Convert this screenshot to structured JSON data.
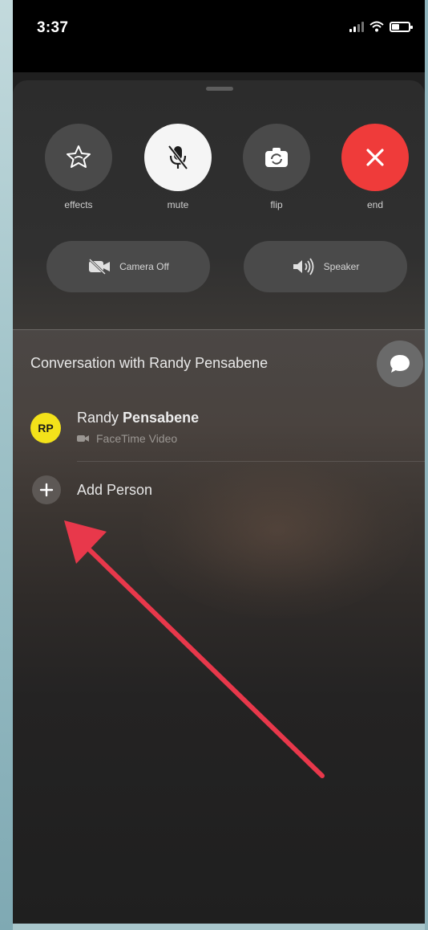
{
  "status_bar": {
    "time": "3:37"
  },
  "controls": [
    {
      "icon": "effects-star-icon",
      "label": "effects",
      "style": "gray"
    },
    {
      "icon": "mic-muted-icon",
      "label": "mute",
      "style": "white"
    },
    {
      "icon": "camera-flip-icon",
      "label": "flip",
      "style": "gray"
    },
    {
      "icon": "close-icon",
      "label": "end",
      "style": "red"
    }
  ],
  "pills": [
    {
      "icon": "video-off-icon",
      "label": "Camera Off"
    },
    {
      "icon": "speaker-icon",
      "label": "Speaker"
    }
  ],
  "conversation": {
    "title": "Conversation with Randy Pensabene",
    "participant": {
      "initials": "RP",
      "first_name": "Randy",
      "last_name": "Pensabene",
      "subtitle": "FaceTime Video"
    },
    "add_person_label": "Add Person"
  },
  "colors": {
    "end_red": "#ef3b3a",
    "avatar_yellow": "#f3e21a",
    "annotation_arrow": "#e8384b"
  }
}
